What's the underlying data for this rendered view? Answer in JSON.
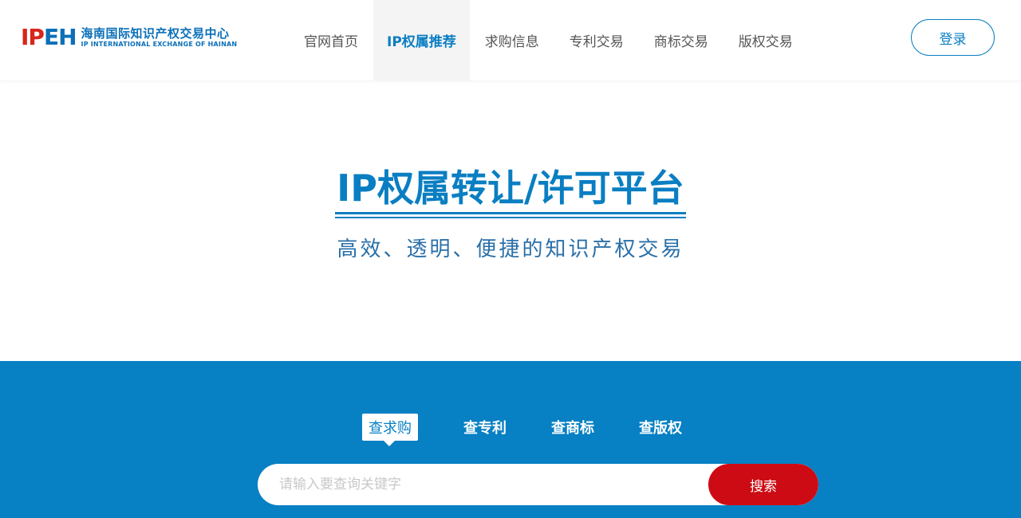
{
  "header": {
    "logo": {
      "letters": "IPEH",
      "name_cn": "海南国际知识产权交易中心",
      "name_en": "IP INTERNATIONAL EXCHANGE OF HAINAN"
    },
    "nav": [
      {
        "label": "官网首页",
        "active": false
      },
      {
        "label": "IP权属推荐",
        "active": true
      },
      {
        "label": "求购信息",
        "active": false
      },
      {
        "label": "专利交易",
        "active": false
      },
      {
        "label": "商标交易",
        "active": false
      },
      {
        "label": "版权交易",
        "active": false
      }
    ],
    "login_label": "登录"
  },
  "hero": {
    "title": "IP权属转让/许可平台",
    "subtitle": "高效、透明、便捷的知识产权交易"
  },
  "search": {
    "tabs": [
      {
        "label": "查求购",
        "active": true
      },
      {
        "label": "查专利",
        "active": false
      },
      {
        "label": "查商标",
        "active": false
      },
      {
        "label": "查版权",
        "active": false
      }
    ],
    "placeholder": "请输入要查询关键字",
    "button_label": "搜索"
  },
  "colors": {
    "primary": "#0780c4",
    "accent_red": "#cd0b14",
    "nav_active_bg": "#f4f4f4"
  }
}
